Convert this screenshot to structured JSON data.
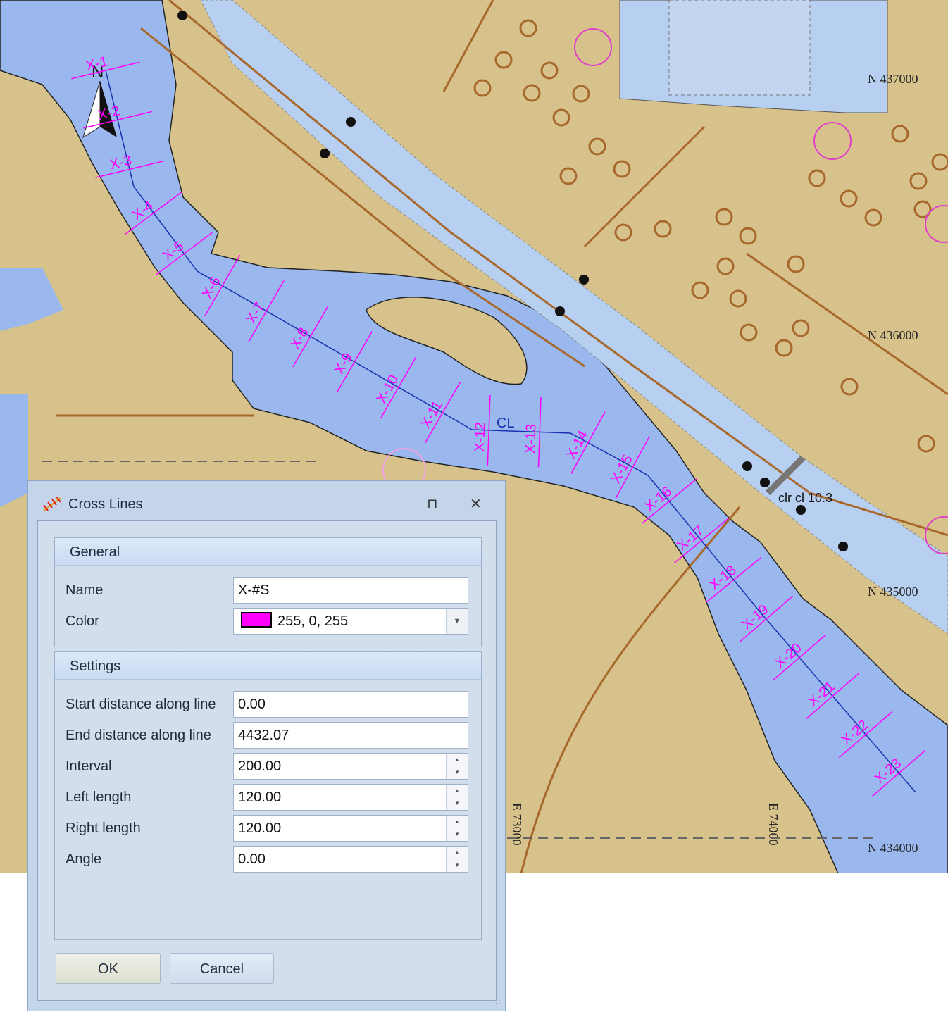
{
  "map": {
    "colors": {
      "land": "#d6c28a",
      "water": "#9ab8ee",
      "channel": "#b7cff0",
      "road": "#a8682c",
      "cross_line": "#ff00ff",
      "centerline": "#1c2fb0"
    },
    "centerline_label": "CL",
    "cross_line_labels": [
      "X-1",
      "X-2",
      "X-3",
      "X-4",
      "X-5",
      "X-6",
      "X-7",
      "X-8",
      "X-9",
      "X-10",
      "X-11",
      "X-12",
      "X-13",
      "X-14",
      "X-15",
      "X-16",
      "X-17",
      "X-18",
      "X-19",
      "X-20",
      "X-21",
      "X-22",
      "X-23"
    ],
    "north_label": "N",
    "grid_labels": {
      "n437000": "N 437000",
      "n436000": "N 436000",
      "n435000": "N 435000",
      "n434000": "N 434000",
      "e73000": "E 73000",
      "e74000": "E 74000"
    },
    "clearance_label": "clr cl 10.3"
  },
  "dialog": {
    "title": "Cross Lines",
    "pin_icon": "pin-icon",
    "close_icon": "close-icon",
    "general": {
      "header": "General",
      "name_label": "Name",
      "name_value": "X-#S",
      "color_label": "Color",
      "color_value": "255, 0, 255",
      "color_hex": "#ff00ff"
    },
    "settings": {
      "header": "Settings",
      "start_label": "Start distance along line",
      "start_value": "0.00",
      "end_label": "End distance along line",
      "end_value": "4432.07",
      "interval_label": "Interval",
      "interval_value": "200.00",
      "left_label": "Left length",
      "left_value": "120.00",
      "right_label": "Right length",
      "right_value": "120.00",
      "angle_label": "Angle",
      "angle_value": "0.00"
    },
    "ok_label": "OK",
    "cancel_label": "Cancel"
  }
}
